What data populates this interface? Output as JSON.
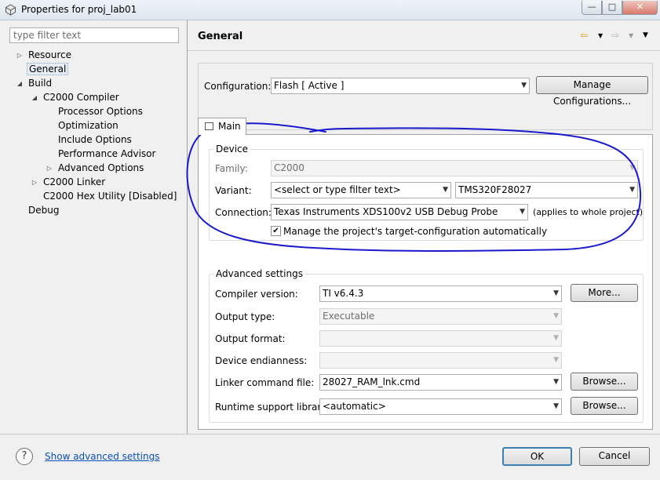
{
  "window": {
    "title": "Properties for proj_lab01",
    "controls": {
      "minimize": "—",
      "maximize": "□",
      "close": "✕"
    }
  },
  "filter": {
    "placeholder": "type filter text"
  },
  "tree": {
    "resource": "Resource",
    "general": "General",
    "build": "Build",
    "c2000_compiler": "C2000 Compiler",
    "processor_options": "Processor Options",
    "optimization": "Optimization",
    "include_options": "Include Options",
    "performance_advisor": "Performance Advisor",
    "advanced_options": "Advanced Options",
    "c2000_linker": "C2000 Linker",
    "c2000_hex_utility": "C2000 Hex Utility  [Disabled]",
    "debug": "Debug"
  },
  "page": {
    "title": "General"
  },
  "configuration": {
    "label": "Configuration:",
    "value": "Flash  [ Active ]",
    "manage_button": "Manage Configurations..."
  },
  "tab": {
    "main": "Main"
  },
  "device": {
    "group_title": "Device",
    "family_label": "Family:",
    "family_value": "C2000",
    "variant_label": "Variant:",
    "variant_filter": "<select or type filter text>",
    "variant_value": "TMS320F28027",
    "connection_label": "Connection:",
    "connection_value": "Texas Instruments XDS100v2 USB Debug Probe",
    "connection_note": "(applies to whole project)",
    "manage_target_label": "Manage the project's target-configuration automatically",
    "manage_target_checked": true
  },
  "advanced": {
    "group_title": "Advanced settings",
    "compiler_version_label": "Compiler version:",
    "compiler_version_value": "TI v6.4.3",
    "more_button": "More...",
    "output_type_label": "Output type:",
    "output_type_value": "Executable",
    "output_format_label": "Output format:",
    "output_format_value": "",
    "endianness_label": "Device endianness:",
    "endianness_value": "",
    "linker_cmd_label": "Linker command file:",
    "linker_cmd_value": "28027_RAM_lnk.cmd",
    "browse_button": "Browse...",
    "runtime_lib_label": "Runtime support library:",
    "runtime_lib_value": "<automatic>",
    "browse_button_2": "Browse..."
  },
  "footer": {
    "help": "?",
    "show_advanced": "Show advanced settings",
    "ok": "OK",
    "cancel": "Cancel"
  },
  "colors": {
    "link": "#0a4fb8",
    "annotation_ink": "#1a1acc",
    "ok_border": "#3c7fb1"
  }
}
